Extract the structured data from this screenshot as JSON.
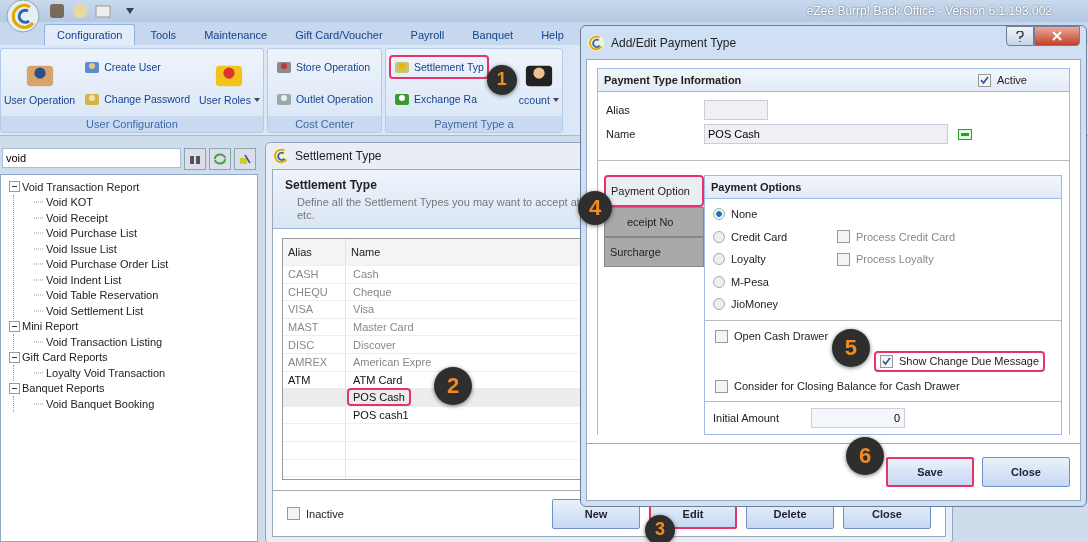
{
  "window": {
    "title": "eZee Burrp! Back Office - Version 6.1.193.002"
  },
  "menu_tabs": [
    {
      "label": "Configuration",
      "selected": true
    },
    {
      "label": "Tools",
      "selected": false
    },
    {
      "label": "Maintenance",
      "selected": false
    },
    {
      "label": "Gift Card/Voucher",
      "selected": false
    },
    {
      "label": "Payroll",
      "selected": false
    },
    {
      "label": "Banquet",
      "selected": false
    },
    {
      "label": "Help",
      "selected": false
    }
  ],
  "ribbon": [
    {
      "label": "User Configuration",
      "items": [
        {
          "kind": "large",
          "label": "User Operation",
          "dropdown": false
        },
        {
          "kind": "stack",
          "items": [
            {
              "label": "Create User"
            },
            {
              "label": "Change Password"
            }
          ]
        },
        {
          "kind": "large",
          "label": "User Roles",
          "dropdown": true
        }
      ]
    },
    {
      "label": "Cost Center",
      "items": [
        {
          "kind": "stack",
          "items": [
            {
              "label": "Store Operation"
            },
            {
              "label": "Outlet Operation"
            }
          ]
        }
      ]
    },
    {
      "label": "Payment Type a",
      "items": [
        {
          "kind": "stack",
          "items": [
            {
              "label": "Settlement Typ",
              "annotation": "1"
            },
            {
              "label": "Exchange Ra"
            }
          ]
        },
        {
          "kind": "large",
          "label": "ccount",
          "dropdown": true
        }
      ]
    }
  ],
  "search": {
    "value": "void"
  },
  "tree": [
    {
      "label": "Void Transaction Report",
      "expanded": true,
      "children": [
        {
          "label": "Void KOT"
        },
        {
          "label": "Void Receipt"
        },
        {
          "label": "Void Purchase List"
        },
        {
          "label": "Void Issue List"
        },
        {
          "label": "Void Purchase Order List"
        },
        {
          "label": "Void Indent List"
        },
        {
          "label": "Void Table Reservation"
        },
        {
          "label": "Void Settlement List"
        }
      ]
    },
    {
      "label": "Mini Report",
      "expanded": true,
      "children": [
        {
          "label": "Void Transaction Listing"
        }
      ]
    },
    {
      "label": "Gift Card Reports",
      "expanded": true,
      "children": [
        {
          "label": "Loyalty Void Transaction"
        }
      ]
    },
    {
      "label": "Banquet Reports",
      "expanded": true,
      "children": [
        {
          "label": "Void Banquet Booking"
        }
      ]
    }
  ],
  "settlement_window": {
    "title": "Settlement Type",
    "heading": "Settlement Type",
    "description": "Define all the Settlement Types you may want to accept at",
    "description_2": "etc.",
    "columns": [
      "Alias",
      "Name"
    ],
    "rows": [
      {
        "alias": "CASH",
        "name": "Cash",
        "dimmed": true,
        "selected": false
      },
      {
        "alias": "CHEQU",
        "name": "Cheque",
        "dimmed": true,
        "selected": false
      },
      {
        "alias": "VISA",
        "name": "Visa",
        "dimmed": true,
        "selected": false
      },
      {
        "alias": "MAST",
        "name": "Master Card",
        "dimmed": true,
        "selected": false
      },
      {
        "alias": "DISC",
        "name": "Discover",
        "dimmed": true,
        "selected": false
      },
      {
        "alias": "AMREX",
        "name": "American Expre",
        "dimmed": true,
        "selected": false
      },
      {
        "alias": "ATM",
        "name": "ATM Card",
        "dimmed": false,
        "selected": false
      },
      {
        "name": "POS Cash",
        "dimmed": false,
        "selected": true,
        "annotation": "2"
      },
      {
        "name": "POS cash1",
        "dimmed": false,
        "selected": false
      }
    ],
    "inactive": {
      "label": "Inactive",
      "checked": false
    },
    "buttons": [
      {
        "label": "New"
      },
      {
        "label": "Edit",
        "annotation": "3"
      },
      {
        "label": "Delete"
      },
      {
        "label": "Close"
      }
    ]
  },
  "dialog": {
    "title": "Add/Edit Payment Type",
    "section": "Payment Type Information",
    "active": {
      "label": "Active",
      "checked": true
    },
    "fields": [
      {
        "label": "Alias"
      },
      {
        "label": "Name",
        "value": "POS Cash"
      }
    ],
    "side_tabs": [
      {
        "label": "Payment Option",
        "selected": true,
        "annotation": "4"
      },
      {
        "label": "eceipt No",
        "selected": false
      },
      {
        "label": "Surcharge",
        "selected": false
      }
    ],
    "options_title": "Payment Options",
    "options": [
      {
        "label": "None",
        "selected": true
      },
      {
        "label": "Credit Card",
        "selected": false,
        "extra": {
          "label": "Process Credit Card",
          "checked": false,
          "disabled": true
        }
      },
      {
        "label": "Loyalty",
        "selected": false,
        "extra": {
          "label": "Process Loyalty",
          "checked": false,
          "disabled": true
        }
      },
      {
        "label": "M-Pesa",
        "selected": false
      },
      {
        "label": "JioMoney",
        "selected": false
      }
    ],
    "checks": [
      {
        "label": "Open Cash Drawer",
        "checked": false
      },
      {
        "label": "Show Change Due Message",
        "checked": true,
        "annotation": "5"
      },
      {
        "label": "Consider for Closing Balance for Cash Drawer",
        "checked": false
      }
    ],
    "initial_amount": {
      "label": "Initial Amount",
      "value": "0"
    },
    "buttons": [
      {
        "label": "Save",
        "annotation": "6"
      },
      {
        "label": "Close"
      }
    ]
  }
}
